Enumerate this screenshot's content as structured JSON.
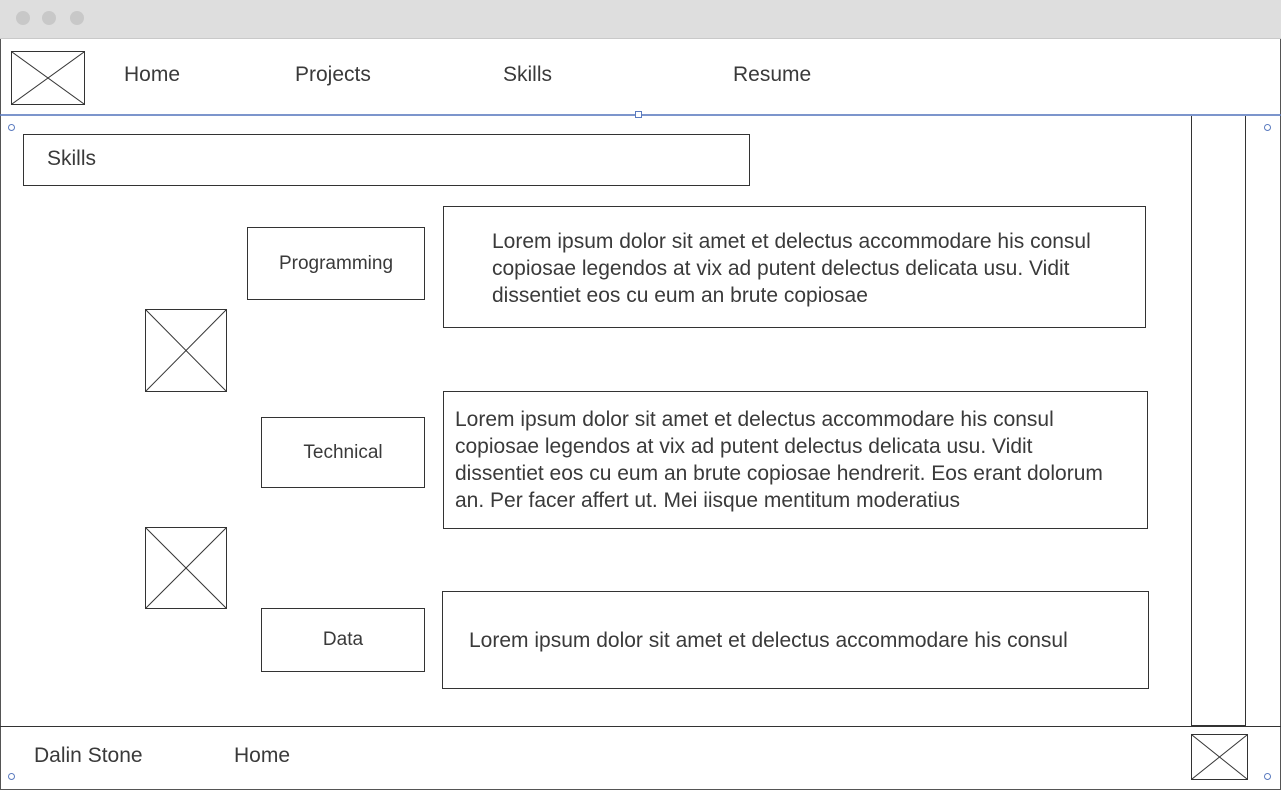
{
  "nav": {
    "items": [
      {
        "label": "Home"
      },
      {
        "label": "Projects"
      },
      {
        "label": "Skills"
      },
      {
        "label": "Resume"
      }
    ]
  },
  "main": {
    "section_title": "Skills",
    "skills": [
      {
        "label": "Programming",
        "description": "Lorem ipsum dolor sit amet et delectus accommodare his consul copiosae legendos at vix ad putent delectus delicata usu. Vidit dissentiet eos cu eum an brute copiosae"
      },
      {
        "label": "Technical",
        "description": "Lorem ipsum dolor sit amet et delectus accommodare his consul copiosae legendos at vix ad putent delectus delicata usu. Vidit dissentiet eos cu eum an brute copiosae hendrerit. Eos erant dolorum an. Per facer affert ut. Mei iisque mentitum moderatius"
      },
      {
        "label": "Data",
        "description": "Lorem ipsum dolor sit amet et delectus accommodare his consul"
      }
    ]
  },
  "footer": {
    "name": "Dalin Stone",
    "home_link": "Home"
  },
  "colors": {
    "selection_accent": "#5b7bbf",
    "titlebar": "#dedede"
  }
}
